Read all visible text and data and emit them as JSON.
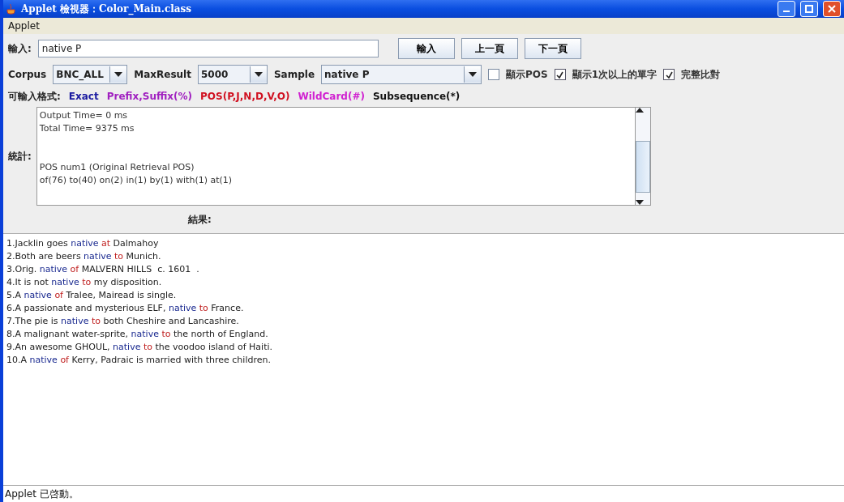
{
  "window": {
    "title": "Applet 檢視器：Color_Main.class"
  },
  "menu": [
    "Applet"
  ],
  "input": {
    "label": "輸入:",
    "value": "native P"
  },
  "buttons": [
    "輸入",
    "上一頁",
    "下一頁"
  ],
  "options": [
    {
      "kind": "combo",
      "label": "Corpus",
      "value": "BNC_ALL"
    },
    {
      "kind": "combo",
      "label": "MaxResult",
      "value": "5000"
    },
    {
      "kind": "combo",
      "label": "Sample",
      "value": "native P"
    },
    {
      "kind": "checkbox",
      "label": "顯示POS",
      "checked": false
    },
    {
      "kind": "checkbox",
      "label": "顯示1次以上的單字",
      "checked": true
    },
    {
      "kind": "checkbox",
      "label": "完整比對",
      "checked": true
    }
  ],
  "formats": {
    "label": "可輸入格式:",
    "items": [
      {
        "text": "Exact",
        "color": "#1a1aa0"
      },
      {
        "text": "Prefix,Suffix(%)",
        "color": "#a020c0"
      },
      {
        "text": "POS(P,J,N,D,V,O)",
        "color": "#d01020"
      },
      {
        "text": "WildCard(#)",
        "color": "#d020d0"
      },
      {
        "text": "Subsequence(*)",
        "color": "#111111"
      }
    ]
  },
  "stats": {
    "label": "統計:",
    "blocks": [
      [
        "Output Time= 0 ms",
        "Total Time= 9375 ms"
      ],
      [
        "POS num1 (Original Retrieval POS)",
        "of(76) to(40) on(2) in(1) by(1) with(1) at(1)"
      ]
    ]
  },
  "results_label": "結果:",
  "results": [
    [
      {
        "kind": "plain",
        "text": "1.Jacklin goes "
      },
      {
        "kind": "word",
        "text": "native "
      },
      {
        "kind": "prep",
        "text": "at"
      },
      {
        "kind": "plain",
        "text": " Dalmahoy"
      }
    ],
    [
      {
        "kind": "plain",
        "text": "2.Both are beers "
      },
      {
        "kind": "word",
        "text": "native "
      },
      {
        "kind": "prep",
        "text": "to"
      },
      {
        "kind": "plain",
        "text": " Munich."
      }
    ],
    [
      {
        "kind": "plain",
        "text": "3.Orig. "
      },
      {
        "kind": "word",
        "text": "native "
      },
      {
        "kind": "prep",
        "text": "of"
      },
      {
        "kind": "plain",
        "text": " MALVERN HILLS  c. 1601  ."
      }
    ],
    [
      {
        "kind": "plain",
        "text": "4.It is not "
      },
      {
        "kind": "word",
        "text": "native "
      },
      {
        "kind": "prep",
        "text": "to"
      },
      {
        "kind": "plain",
        "text": " my disposition."
      }
    ],
    [
      {
        "kind": "plain",
        "text": "5.A "
      },
      {
        "kind": "word",
        "text": "native "
      },
      {
        "kind": "prep",
        "text": "of"
      },
      {
        "kind": "plain",
        "text": " Tralee, Mairead is single."
      }
    ],
    [
      {
        "kind": "plain",
        "text": "6.A passionate and mysterious ELF, "
      },
      {
        "kind": "word",
        "text": "native "
      },
      {
        "kind": "prep",
        "text": "to"
      },
      {
        "kind": "plain",
        "text": " France."
      }
    ],
    [
      {
        "kind": "plain",
        "text": "7.The pie is "
      },
      {
        "kind": "word",
        "text": "native "
      },
      {
        "kind": "prep",
        "text": "to"
      },
      {
        "kind": "plain",
        "text": " both Cheshire and Lancashire."
      }
    ],
    [
      {
        "kind": "plain",
        "text": "8.A malignant water-sprite, "
      },
      {
        "kind": "word",
        "text": "native "
      },
      {
        "kind": "prep",
        "text": "to"
      },
      {
        "kind": "plain",
        "text": " the north of England."
      }
    ],
    [
      {
        "kind": "plain",
        "text": "9.An awesome GHOUL, "
      },
      {
        "kind": "word",
        "text": "native "
      },
      {
        "kind": "prep",
        "text": "to"
      },
      {
        "kind": "plain",
        "text": " the voodoo island of Haiti."
      }
    ],
    [
      {
        "kind": "plain",
        "text": "10.A "
      },
      {
        "kind": "word",
        "text": "native "
      },
      {
        "kind": "prep",
        "text": "of"
      },
      {
        "kind": "plain",
        "text": " Kerry, Padraic is married with three children."
      }
    ]
  ],
  "status_bar": "Applet 已啓動。"
}
